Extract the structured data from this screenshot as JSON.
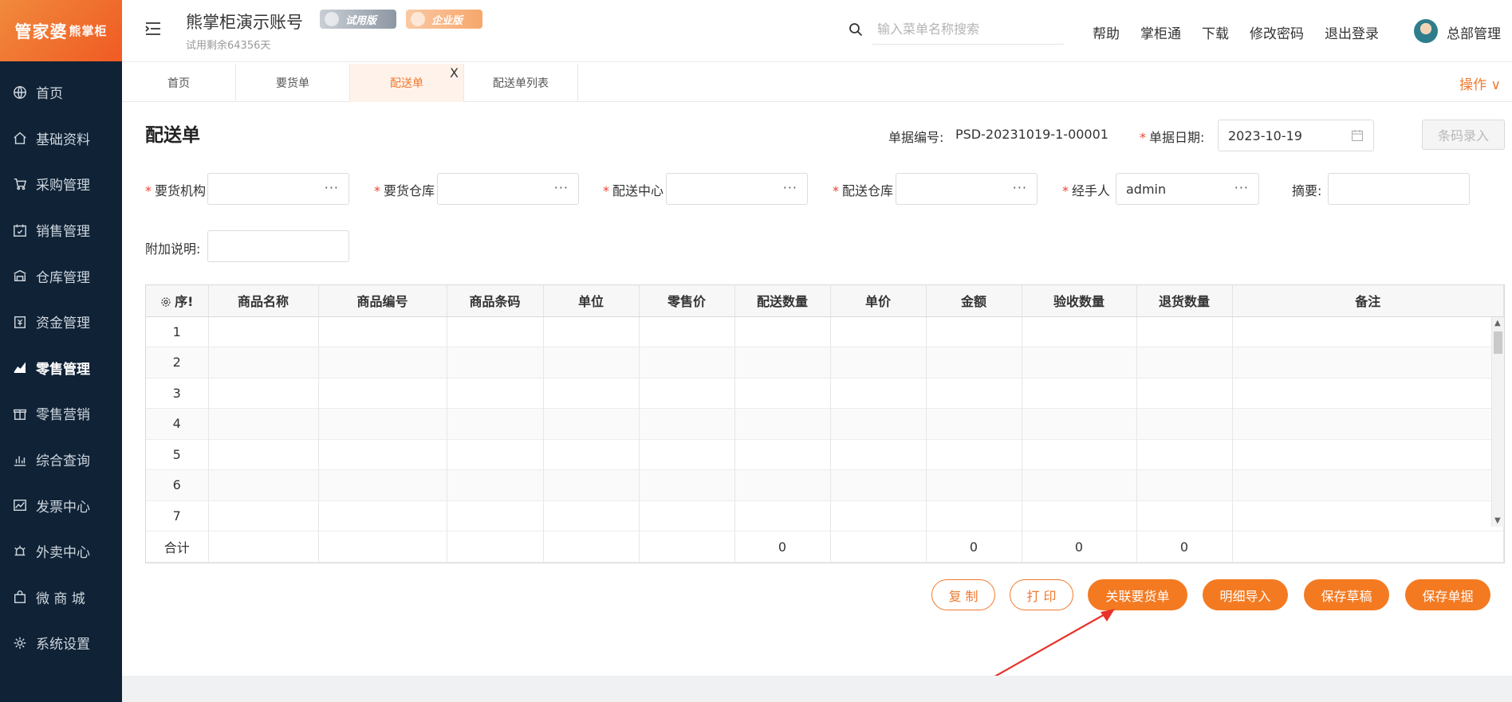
{
  "brand": {
    "logo_main": "管家婆",
    "logo_sub": "熊掌柜"
  },
  "sidebar": {
    "items": [
      {
        "label": "首页",
        "icon": "globe-icon",
        "active": false
      },
      {
        "label": "基础资料",
        "icon": "home-icon",
        "active": false
      },
      {
        "label": "采购管理",
        "icon": "cart-icon",
        "active": false
      },
      {
        "label": "销售管理",
        "icon": "calendar-check-icon",
        "active": false
      },
      {
        "label": "仓库管理",
        "icon": "warehouse-icon",
        "active": false
      },
      {
        "label": "资金管理",
        "icon": "money-icon",
        "active": false
      },
      {
        "label": "零售管理",
        "icon": "area-chart-icon",
        "active": true
      },
      {
        "label": "零售营销",
        "icon": "gift-icon",
        "active": false
      },
      {
        "label": "综合查询",
        "icon": "bar-chart-icon",
        "active": false
      },
      {
        "label": "发票中心",
        "icon": "trend-icon",
        "active": false
      },
      {
        "label": "外卖中心",
        "icon": "alarm-icon",
        "active": false
      },
      {
        "label": "微 商 城",
        "icon": "bag-icon",
        "active": false
      },
      {
        "label": "系统设置",
        "icon": "gear-icon",
        "active": false
      }
    ]
  },
  "header": {
    "account_title": "熊掌柜演示账号",
    "trial_badge": "试用版",
    "enterprise_badge": "企业版",
    "trial_remaining": "试用剩余64356天",
    "search_placeholder": "输入菜单名称搜索",
    "links": [
      "帮助",
      "掌柜通",
      "下载",
      "修改密码",
      "退出登录"
    ],
    "user_name": "总部管理"
  },
  "tabs": {
    "items": [
      {
        "label": "首页",
        "active": false
      },
      {
        "label": "要货单",
        "active": false
      },
      {
        "label": "配送单",
        "active": true,
        "close": "X"
      },
      {
        "label": "配送单列表",
        "active": false
      }
    ],
    "operations": "操作 ∨"
  },
  "form": {
    "title": "配送单",
    "doc_no_label": "单据编号:",
    "doc_no": "PSD-20231019-1-00001",
    "date_label": "单据日期:",
    "date_value": "2023-10-19",
    "barcode_button": "条码录入",
    "fields": {
      "req_org": {
        "label": "要货机构",
        "value": ""
      },
      "req_wh": {
        "label": "要货仓库",
        "value": ""
      },
      "dist_center": {
        "label": "配送中心",
        "value": ""
      },
      "dist_wh": {
        "label": "配送仓库",
        "value": ""
      },
      "handler": {
        "label": "经手人",
        "value": "admin"
      },
      "summary": {
        "label": "摘要:",
        "value": ""
      },
      "note": {
        "label": "附加说明:",
        "value": ""
      }
    },
    "dots": "···",
    "required_mark": "*"
  },
  "grid": {
    "columns": [
      "序号",
      "商品名称",
      "商品编号",
      "商品条码",
      "单位",
      "零售价",
      "配送数量",
      "单价",
      "金额",
      "验收数量",
      "退货数量",
      "备注"
    ],
    "seq_header": "序!",
    "rows": [
      "1",
      "2",
      "3",
      "4",
      "5",
      "6",
      "7"
    ],
    "total_label": "合计",
    "totals": {
      "dist_qty": "0",
      "amount": "0",
      "accept_qty": "0",
      "return_qty": "0"
    }
  },
  "actions": {
    "copy": "复 制",
    "print": "打 印",
    "link_request": "关联要货单",
    "import_detail": "明细导入",
    "save_draft": "保存草稿",
    "save_doc": "保存单据"
  },
  "colors": {
    "accent": "#f47a22",
    "sidebar_bg": "#0f2236",
    "required": "#f0442f",
    "annotation_arrow": "#e8332a"
  }
}
